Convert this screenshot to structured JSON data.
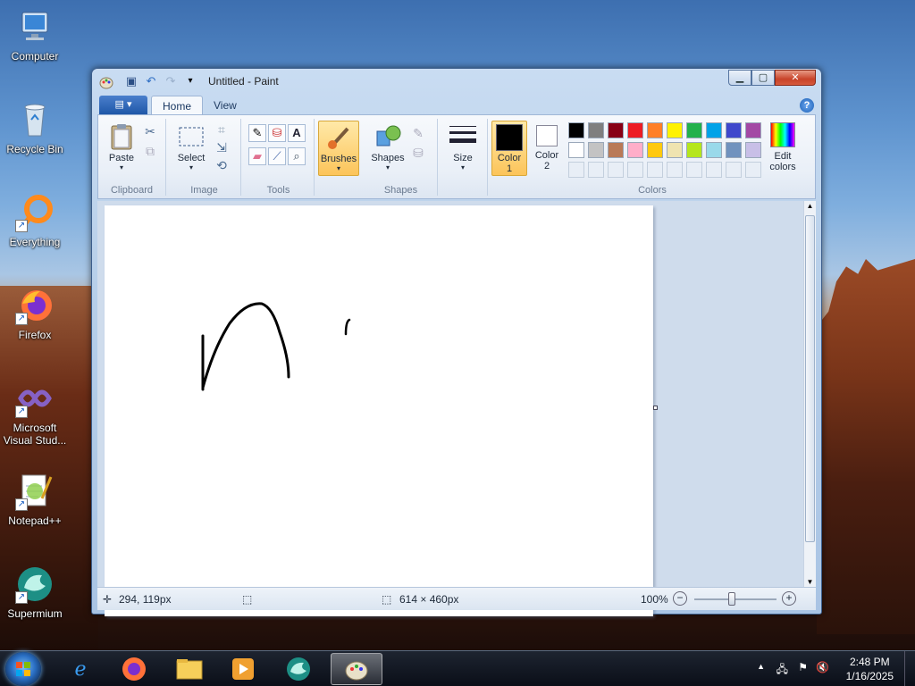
{
  "desktop": {
    "icons": [
      {
        "label": "Computer",
        "icon": "computer-icon"
      },
      {
        "label": "Recycle Bin",
        "icon": "recycle-bin-icon"
      },
      {
        "label": "Everything",
        "icon": "everything-icon"
      },
      {
        "label": "Firefox",
        "icon": "firefox-icon"
      },
      {
        "label": "Microsoft Visual Stud...",
        "label_line1": "Microsoft",
        "label_line2": "Visual Stud...",
        "icon": "visual-studio-icon"
      },
      {
        "label": "Notepad++",
        "icon": "notepadpp-icon"
      },
      {
        "label": "Supermium",
        "icon": "supermium-icon"
      }
    ]
  },
  "window": {
    "title": "Untitled - Paint",
    "file_menu_label": "▤ ▾",
    "tabs": [
      {
        "label": "Home",
        "active": true
      },
      {
        "label": "View",
        "active": false
      }
    ],
    "ribbon": {
      "clipboard": {
        "label": "Clipboard",
        "paste": "Paste"
      },
      "image": {
        "label": "Image",
        "select": "Select"
      },
      "tools": {
        "label": "Tools"
      },
      "brushes": {
        "label": "Brushes"
      },
      "shapes": {
        "label": "Shapes",
        "shapes_btn": "Shapes"
      },
      "size": {
        "label": "Size"
      },
      "colors": {
        "label": "Colors",
        "color1": "Color\n1",
        "color1_line1": "Color",
        "color1_line2": "1",
        "color2_line1": "Color",
        "color2_line2": "2",
        "edit_line1": "Edit",
        "edit_line2": "colors",
        "color1_value": "#000000",
        "color2_value": "#ffffff",
        "palette_row1": [
          "#000000",
          "#7f7f7f",
          "#880015",
          "#ed1c24",
          "#ff7f27",
          "#fff200",
          "#22b14c",
          "#00a2e8",
          "#3f48cc",
          "#a349a4"
        ],
        "palette_row2": [
          "#ffffff",
          "#c3c3c3",
          "#b97a57",
          "#ffaec9",
          "#ffc90e",
          "#efe4b0",
          "#b5e61d",
          "#99d9ea",
          "#7092be",
          "#c8bfe7"
        ]
      }
    },
    "status": {
      "cursor_pos": "294, 119px",
      "canvas_size": "614 × 460px",
      "zoom": "100%"
    }
  },
  "taskbar": {
    "time": "2:48 PM",
    "date": "1/16/2025",
    "apps": [
      "internet-explorer-icon",
      "firefox-icon",
      "file-explorer-icon",
      "media-player-icon",
      "supermium-icon",
      "paint-icon"
    ]
  }
}
